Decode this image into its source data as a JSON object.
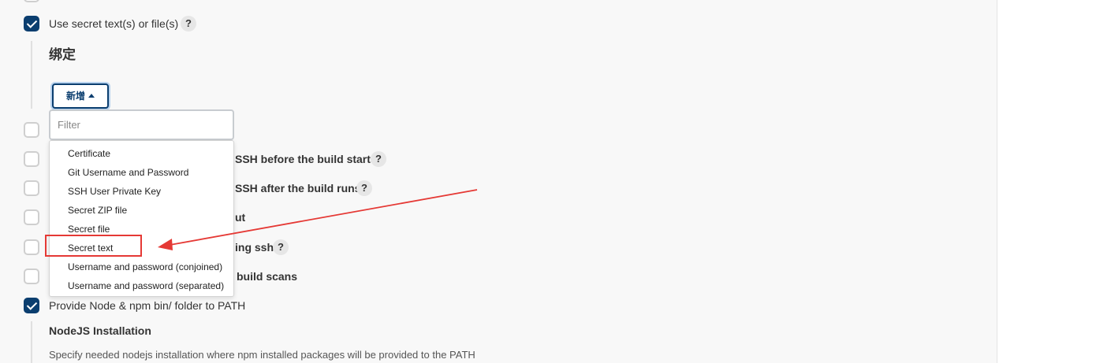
{
  "options": [
    {
      "label": "Use secret text(s) or file(s)",
      "checked": true
    },
    {
      "label": "SSH before the build starts",
      "checked": false
    },
    {
      "label": "SSH after the build runs",
      "checked": false
    },
    {
      "label": "ut",
      "checked": false
    },
    {
      "label": "ing ssh",
      "checked": false
    },
    {
      "label": "build scans",
      "checked": false
    },
    {
      "label": "Provide Node & npm bin/ folder to PATH",
      "checked": true
    }
  ],
  "help_glyph": "?",
  "bindings": {
    "heading": "绑定",
    "add_button_label": "新增",
    "filter_placeholder": "Filter"
  },
  "add_menu": {
    "items": [
      "Certificate",
      "Git Username and Password",
      "SSH User Private Key",
      "Secret ZIP file",
      "Secret file",
      "Secret text",
      "Username and password (conjoined)",
      "Username and password (separated)"
    ],
    "highlighted_item": "Secret text"
  },
  "nodejs": {
    "label": "NodeJS Installation",
    "description": "Specify needed nodejs installation where npm installed packages will be provided to the PATH"
  },
  "colors": {
    "accent": "#0b3e6f",
    "annotation": "#e53935"
  }
}
